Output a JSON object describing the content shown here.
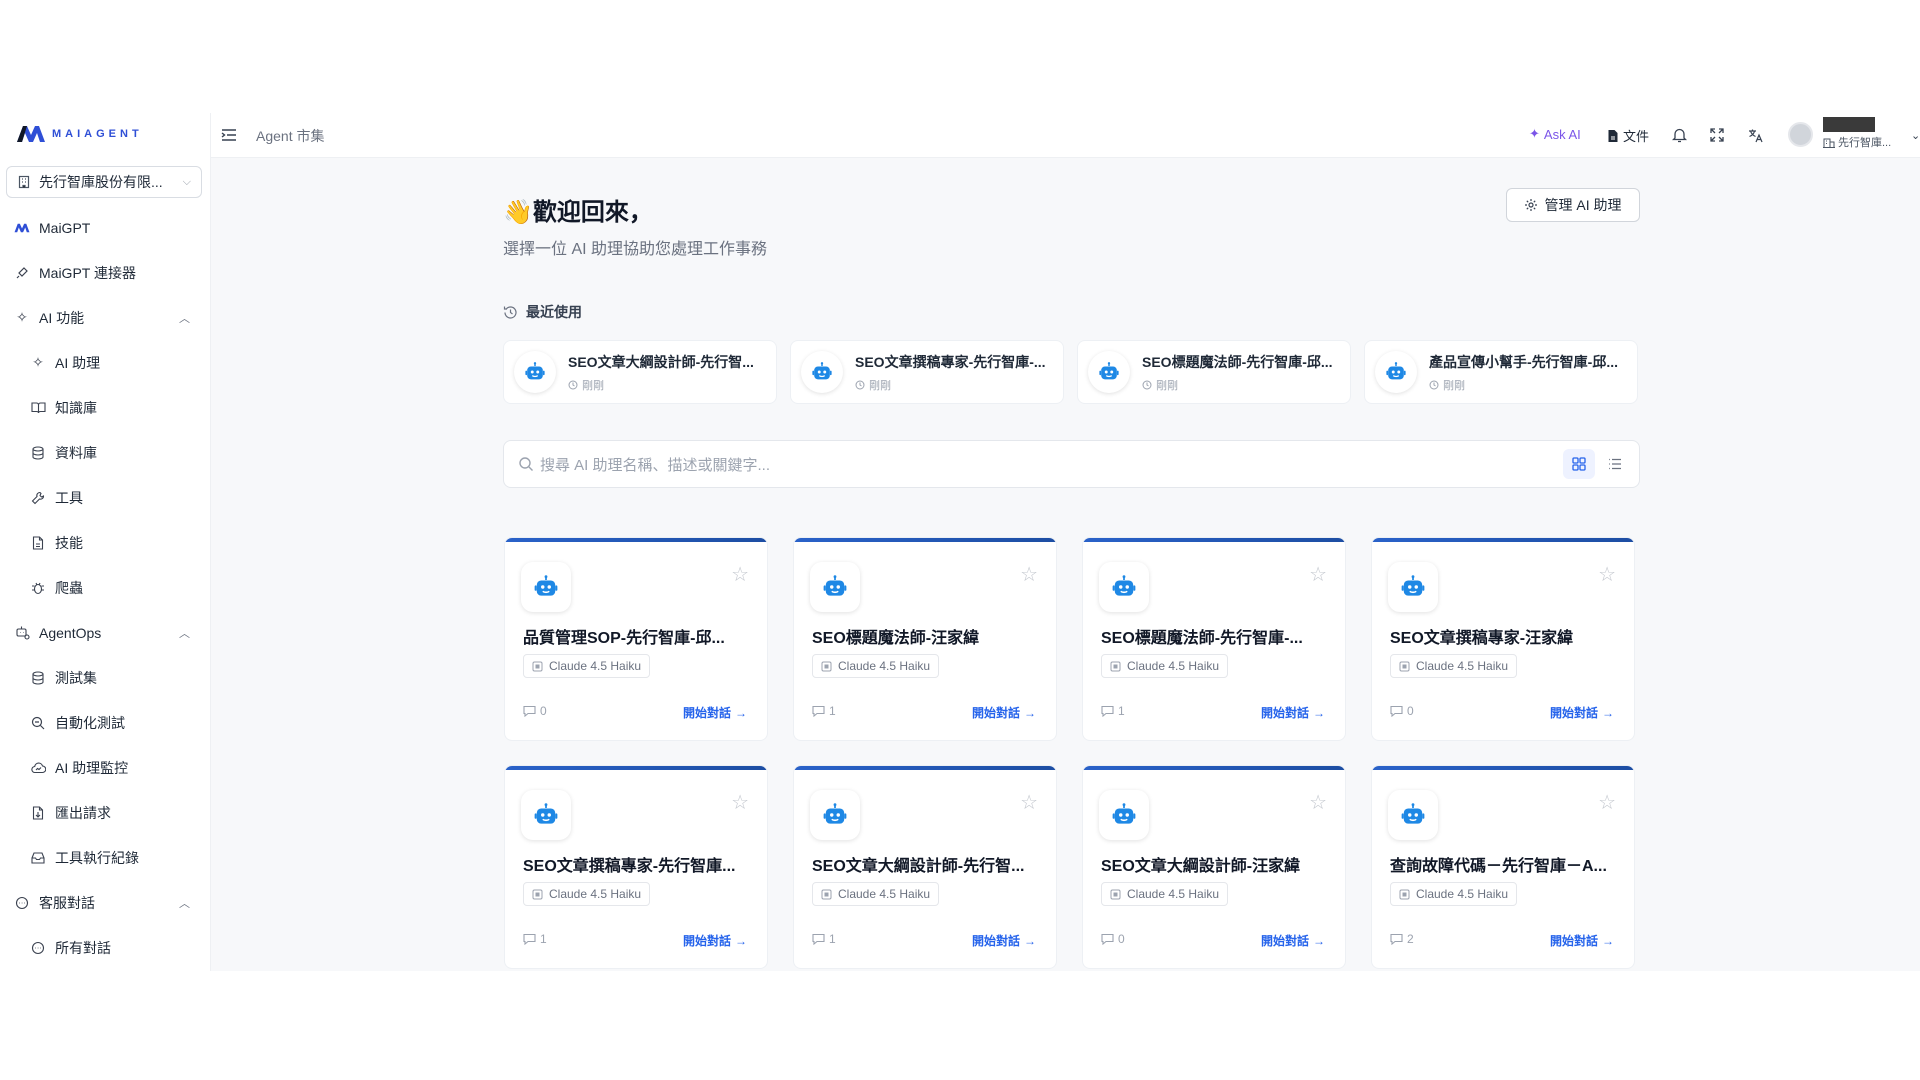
{
  "brand": {
    "logo_text": "MAIAGENT",
    "accent": "#2563eb"
  },
  "sidebar": {
    "org_selector": "先行智庫股份有限...",
    "items": [
      {
        "label": "MaiGPT",
        "icon": "maigpt-logo-icon",
        "level": 0
      },
      {
        "label": "MaiGPT 連接器",
        "icon": "plug-icon",
        "level": 0
      },
      {
        "label": "AI 功能",
        "icon": "sparkles-icon",
        "level": 0,
        "expanded": true
      },
      {
        "label": "AI 助理",
        "icon": "sparkles-icon",
        "level": 1
      },
      {
        "label": "知識庫",
        "icon": "book-icon",
        "level": 1
      },
      {
        "label": "資料庫",
        "icon": "database-icon",
        "level": 1
      },
      {
        "label": "工具",
        "icon": "wrench-icon",
        "level": 1
      },
      {
        "label": "技能",
        "icon": "file-icon",
        "level": 1
      },
      {
        "label": "爬蟲",
        "icon": "bug-icon",
        "level": 1
      },
      {
        "label": "AgentOps",
        "icon": "bot-settings-icon",
        "level": 0,
        "expanded": true
      },
      {
        "label": "測試集",
        "icon": "database-icon",
        "level": 1
      },
      {
        "label": "自動化測試",
        "icon": "search-check-icon",
        "level": 1
      },
      {
        "label": "AI 助理監控",
        "icon": "cloud-monitor-icon",
        "level": 1
      },
      {
        "label": "匯出請求",
        "icon": "file-export-icon",
        "level": 1
      },
      {
        "label": "工具執行紀錄",
        "icon": "tray-icon",
        "level": 1
      },
      {
        "label": "客服對話",
        "icon": "chat-icon",
        "level": 0,
        "expanded": true
      },
      {
        "label": "所有對話",
        "icon": "chat-icon",
        "level": 1
      }
    ]
  },
  "topbar": {
    "breadcrumb": "Agent 市集",
    "ask_ai": "Ask AI",
    "docs": "文件",
    "user_org": "先行智庫..."
  },
  "main": {
    "welcome": "👋歡迎回來，",
    "subtitle": "選擇一位 AI 助理協助您處理工作事務",
    "manage_button": "管理 AI 助理",
    "recent_heading": "最近使用",
    "recent": [
      {
        "name": "SEO文章大綱設計師-先行智...",
        "time": "剛剛"
      },
      {
        "name": "SEO文章撰稿專家-先行智庫-...",
        "time": "剛剛"
      },
      {
        "name": "SEO標題魔法師-先行智庫-邱...",
        "time": "剛剛"
      },
      {
        "name": "產品宣傳小幫手-先行智庫-邱...",
        "time": "剛剛"
      }
    ],
    "search_placeholder": "搜尋 AI 助理名稱、描述或關鍵字...",
    "agents": [
      {
        "title": "品質管理SOP-先行智庫-邱...",
        "model": "Claude 4.5 Haiku",
        "count": "0",
        "action": "開始對話"
      },
      {
        "title": "SEO標題魔法師-汪家緯",
        "model": "Claude 4.5 Haiku",
        "count": "1",
        "action": "開始對話"
      },
      {
        "title": "SEO標題魔法師-先行智庫-...",
        "model": "Claude 4.5 Haiku",
        "count": "1",
        "action": "開始對話"
      },
      {
        "title": "SEO文章撰稿專家-汪家緯",
        "model": "Claude 4.5 Haiku",
        "count": "0",
        "action": "開始對話"
      },
      {
        "title": "SEO文章撰稿專家-先行智庫...",
        "model": "Claude 4.5 Haiku",
        "count": "1",
        "action": "開始對話"
      },
      {
        "title": "SEO文章大綱設計師-先行智...",
        "model": "Claude 4.5 Haiku",
        "count": "1",
        "action": "開始對話"
      },
      {
        "title": "SEO文章大綱設計師-汪家緯",
        "model": "Claude 4.5 Haiku",
        "count": "0",
        "action": "開始對話"
      },
      {
        "title": "查詢故障代碼－先行智庫－A...",
        "model": "Claude 4.5 Haiku",
        "count": "2",
        "action": "開始對話"
      }
    ]
  }
}
